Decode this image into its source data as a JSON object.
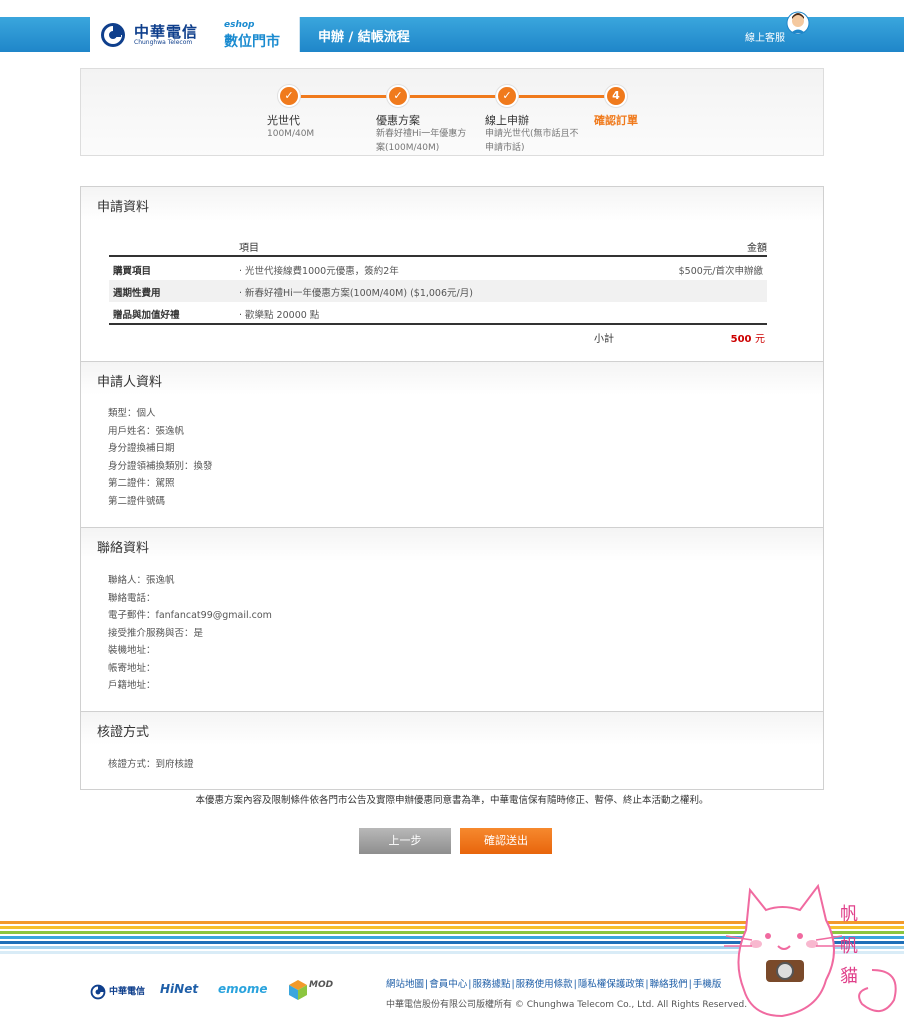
{
  "header": {
    "logo_cn": "中華電信",
    "logo_en": "Chunghwa Telecom",
    "eshop_small": "eshop",
    "eshop_big": "數位門市",
    "title": "申辦 / 結帳流程",
    "customer_service": "線上客服"
  },
  "steps": [
    {
      "num": "✓",
      "name": "光世代",
      "desc": "100M/40M"
    },
    {
      "num": "✓",
      "name": "優惠方案",
      "desc": "新春好禮Hi一年優惠方案(100M/40M)"
    },
    {
      "num": "✓",
      "name": "線上申辦",
      "desc": "申請光世代(無市話且不申請市話)"
    },
    {
      "num": "4",
      "name": "確認訂單",
      "desc": ""
    }
  ],
  "order": {
    "title": "申請資料",
    "col_item": "項目",
    "col_amount": "金額",
    "rows": [
      {
        "label": "購買項目",
        "item": "· 光世代接線費1000元優惠，簽約2年",
        "amount": "$500元/首次申辦繳"
      },
      {
        "label": "週期性費用",
        "item": "· 新春好禮Hi一年優惠方案(100M/40M) ($1,006元/月)",
        "amount": ""
      },
      {
        "label": "贈品與加值好禮",
        "item": "· 歡樂點 20000 點",
        "amount": ""
      }
    ],
    "subtotal_label": "小計",
    "subtotal_value": "500",
    "subtotal_unit": "元"
  },
  "applicant": {
    "title": "申請人資料",
    "lines": [
      "類型：個人",
      "用戶姓名：張逸帆",
      "身分證換補日期",
      "身分證領補換類別：換發",
      "第二證件：駕照",
      "第二證件號碼"
    ]
  },
  "contact": {
    "title": "聯絡資料",
    "lines": [
      "聯絡人：張逸帆",
      "聯絡電話：",
      "電子郵件：fanfancat99@gmail.com",
      "接受推介服務與否：是",
      "裝機地址：",
      "帳寄地址：",
      "戶籍地址："
    ]
  },
  "verify": {
    "title": "核證方式",
    "lines": [
      "核證方式：到府核證"
    ]
  },
  "notice": "本優惠方案內容及限制條件依各門市公告及實際申辦優惠同意書為準，中華電信保有隨時修正、暫停、終止本活動之權利。",
  "buttons": {
    "prev": "上一步",
    "submit": "確認送出"
  },
  "footer": {
    "logos": [
      "中華電信",
      "HiNet",
      "emome",
      "MOD"
    ],
    "links": [
      "網站地圖",
      "會員中心",
      "服務據點",
      "服務使用條款",
      "隱私權保護政策",
      "聯絡我們",
      "手機版"
    ],
    "copyright": "中華電信股份有限公司版權所有 © Chunghwa Telecom Co., Ltd. All Rights Reserved.",
    "watermark": [
      "帆",
      "帆",
      "貓"
    ]
  },
  "colors": {
    "brand_blue": "#1f86c9",
    "accent_orange": "#f07a1c",
    "price_red": "#cc0000"
  }
}
